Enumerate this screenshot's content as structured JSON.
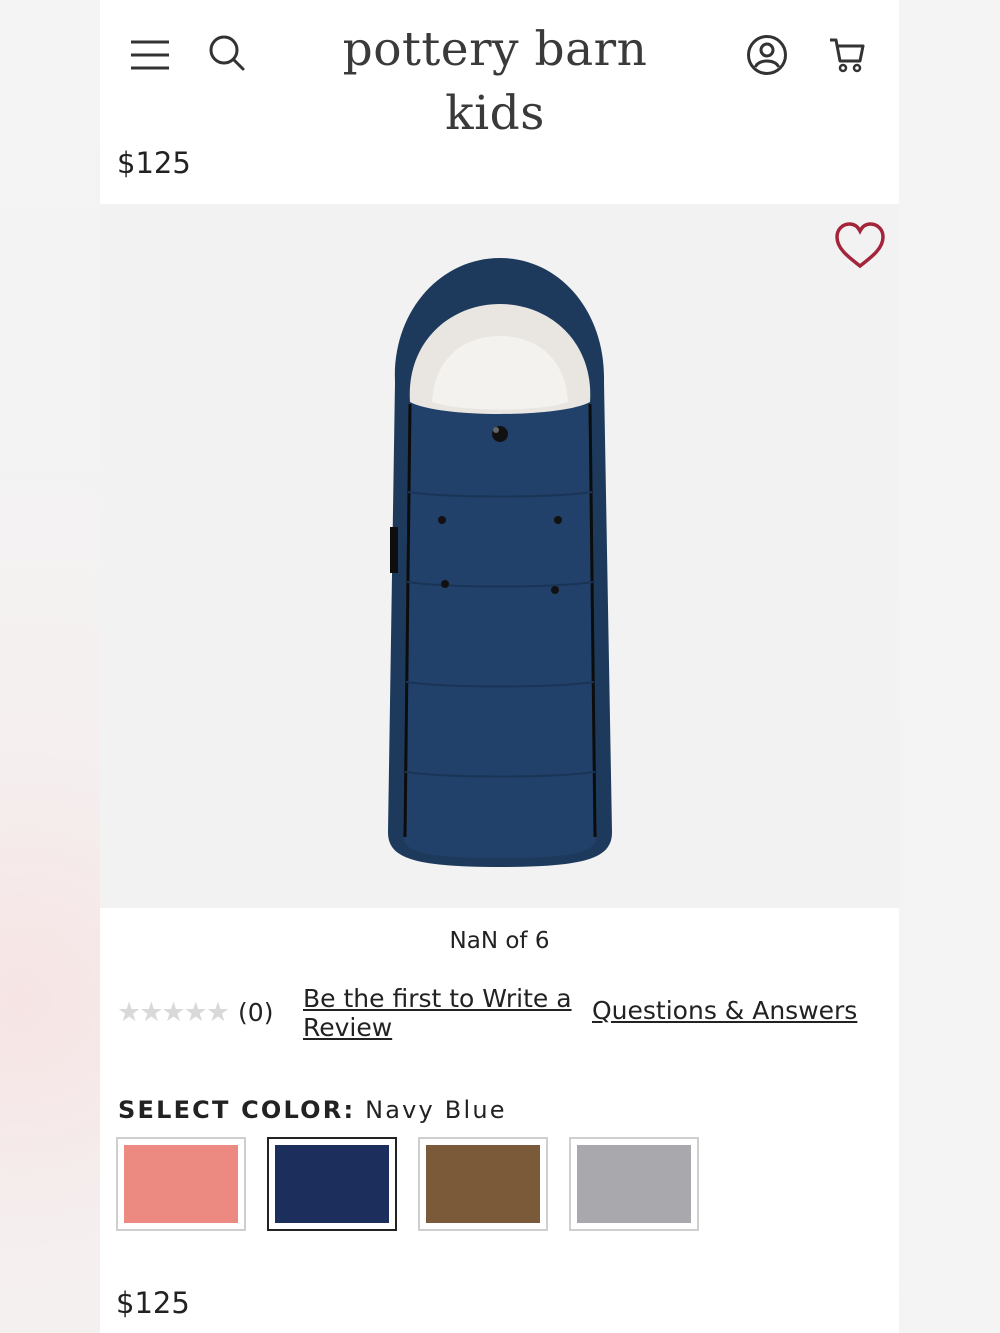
{
  "header": {
    "logo": "pottery barn kids",
    "menu_icon": "hamburger-menu-icon",
    "search_icon": "search-icon",
    "account_icon": "user-account-icon",
    "cart_icon": "shopping-cart-icon"
  },
  "product": {
    "price_top": "$125",
    "image_icon": "navy-footmuff-image",
    "favorite_icon": "heart-icon",
    "favorite_color": "#a4253a",
    "image_counter": "NaN of 6",
    "price_bottom": "$125"
  },
  "reviews": {
    "rating": 0,
    "stars": "★★★★★",
    "count": "(0)",
    "write_review": "Be the first to Write a Review",
    "questions": "Questions & Answers"
  },
  "color_select": {
    "label": "SELECT COLOR:",
    "selected": "Navy Blue",
    "swatches": [
      {
        "color": "#ec8a82",
        "selected": false
      },
      {
        "color": "#1c2e5c",
        "selected": true
      },
      {
        "color": "#7b5a3a",
        "selected": false
      },
      {
        "color": "#a9a9ad",
        "selected": false
      }
    ]
  }
}
